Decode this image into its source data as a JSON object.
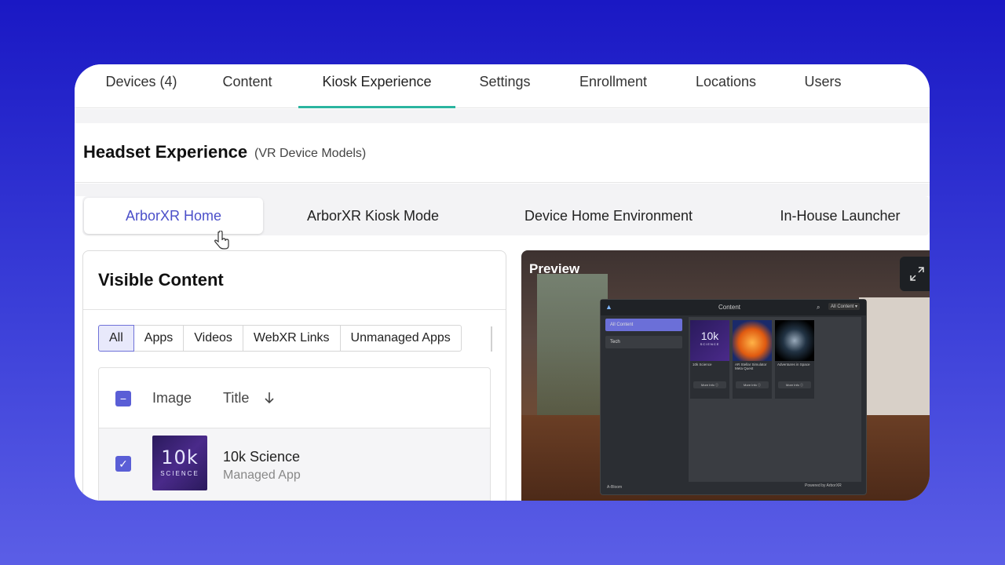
{
  "topnav": {
    "tabs": [
      {
        "label": "Devices (4)"
      },
      {
        "label": "Content"
      },
      {
        "label": "Kiosk Experience"
      },
      {
        "label": "Settings"
      },
      {
        "label": "Enrollment"
      },
      {
        "label": "Locations"
      },
      {
        "label": "Users"
      }
    ],
    "active_index": 2,
    "accent_color": "#2bb5a0"
  },
  "section": {
    "title": "Headset Experience",
    "subtitle": "(VR Device Models)"
  },
  "subtabs": {
    "items": [
      {
        "label": "ArborXR Home"
      },
      {
        "label": "ArborXR Kiosk Mode"
      },
      {
        "label": "Device Home Environment"
      },
      {
        "label": "In-House Launcher"
      }
    ],
    "active_index": 0,
    "active_color": "#4b4fc9"
  },
  "visible_content": {
    "title": "Visible Content",
    "filters": [
      {
        "label": "All"
      },
      {
        "label": "Apps"
      },
      {
        "label": "Videos"
      },
      {
        "label": "WebXR Links"
      },
      {
        "label": "Unmanaged Apps"
      }
    ],
    "active_filter": 0,
    "table": {
      "columns": {
        "image": "Image",
        "title": "Title",
        "sort_icon": "arrow-down-icon"
      },
      "header_checkbox": "−",
      "rows": [
        {
          "checked": "✓",
          "thumb_big": "10k",
          "thumb_small": "SCIENCE",
          "title": "10k Science",
          "subtitle": "Managed App"
        }
      ]
    }
  },
  "preview": {
    "label": "Preview",
    "vr": {
      "title": "Content",
      "search_icon": "search-icon",
      "dropdown": "All Content ▾",
      "sidebar": [
        {
          "label": "All Content"
        },
        {
          "label": "Tech"
        }
      ],
      "cards": [
        {
          "big": "10k",
          "small": "SCIENCE",
          "caption": "10k Science",
          "more": "More Info ⓘ"
        },
        {
          "caption": "AR Stellar Simulator Meta Quest",
          "more": "More Info ⓘ"
        },
        {
          "caption": "Adventures in Space",
          "more": "More Info ⓘ"
        }
      ],
      "footer_left": "A-Bloom",
      "footer_right": "Powered by ArborXR"
    }
  },
  "colors": {
    "brand": "#5a5ed6",
    "background_top": "#1a18c4",
    "background_bottom": "#5b5ee6"
  }
}
